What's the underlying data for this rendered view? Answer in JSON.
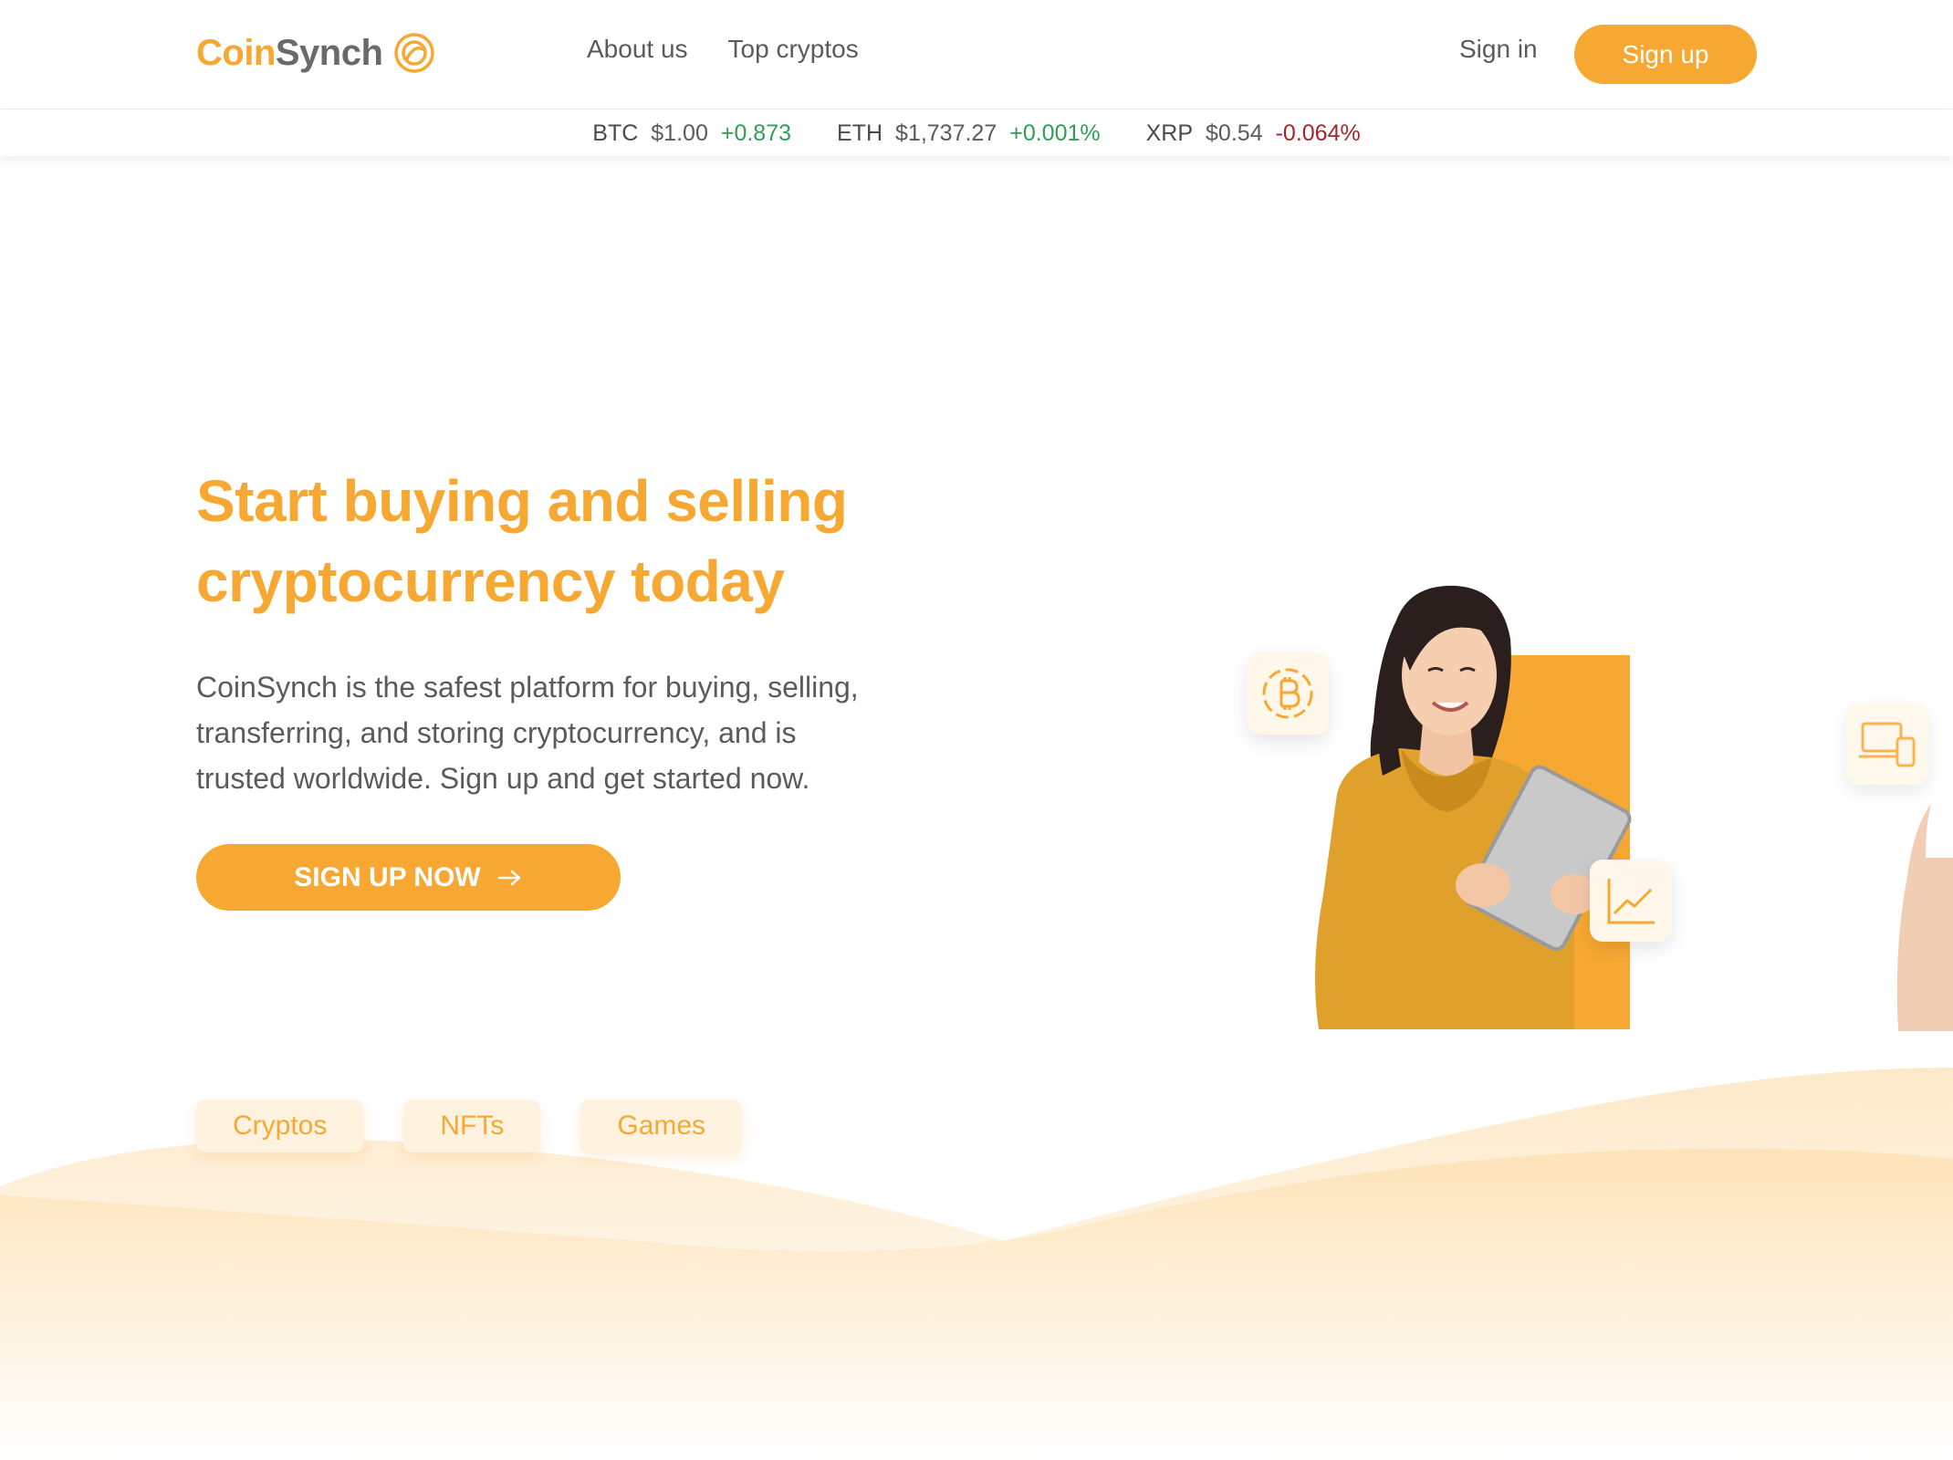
{
  "brand": {
    "name_part1": "Coin",
    "name_part2": "Synch",
    "accent": "#f7a832"
  },
  "nav": {
    "items": [
      {
        "label": "About us"
      },
      {
        "label": "Top cryptos"
      }
    ]
  },
  "auth": {
    "sign_in": "Sign in",
    "sign_up": "Sign up"
  },
  "ticker": [
    {
      "symbol": "BTC",
      "price": "$1.00",
      "change": "+0.873",
      "direction": "up"
    },
    {
      "symbol": "ETH",
      "price": "$1,737.27",
      "change": "+0.001%",
      "direction": "up"
    },
    {
      "symbol": "XRP",
      "price": "$0.54",
      "change": "-0.064%",
      "direction": "down"
    }
  ],
  "hero": {
    "title_line1": "Start buying and selling",
    "title_line2": "cryptocurrency today",
    "text_line1": "CoinSynch is the safest platform for buying, selling,",
    "text_line2": "transferring, and storing cryptocurrency, and is",
    "text_line3": "trusted worldwide. Sign up and get started now.",
    "cta_label": "SIGN UP NOW"
  },
  "illustration": {
    "icons": [
      "bitcoin-icon",
      "chart-icon",
      "devices-icon"
    ]
  },
  "tabs": [
    {
      "label": "Cryptos"
    },
    {
      "label": "NFTs"
    },
    {
      "label": "Games"
    }
  ],
  "colors": {
    "positive": "#2e9f56",
    "negative": "#a6252d",
    "text": "#5b5b5b"
  }
}
